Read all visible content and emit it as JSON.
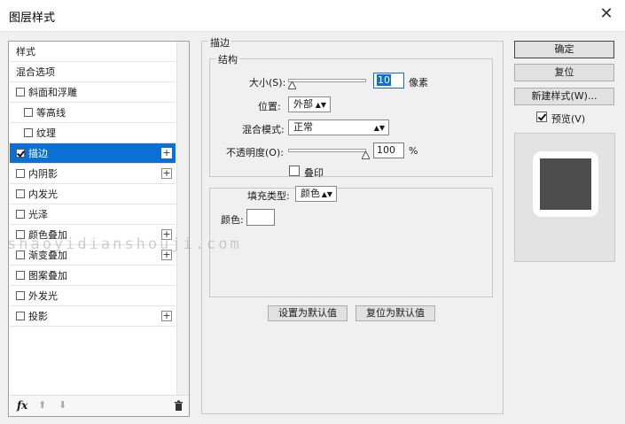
{
  "window": {
    "title": "图层样式"
  },
  "list": {
    "items": [
      {
        "label": "样式",
        "checkbox": false,
        "plus": false,
        "indent": 0
      },
      {
        "label": "混合选项",
        "checkbox": false,
        "plus": false,
        "indent": 0
      },
      {
        "label": "斜面和浮雕",
        "checkbox": true,
        "checked": false,
        "plus": false,
        "indent": 0
      },
      {
        "label": "等高线",
        "checkbox": true,
        "checked": false,
        "plus": false,
        "indent": 1
      },
      {
        "label": "纹理",
        "checkbox": true,
        "checked": false,
        "plus": false,
        "indent": 1
      },
      {
        "label": "描边",
        "checkbox": true,
        "checked": true,
        "plus": true,
        "indent": 0,
        "selected": true
      },
      {
        "label": "内阴影",
        "checkbox": true,
        "checked": false,
        "plus": true,
        "indent": 0
      },
      {
        "label": "内发光",
        "checkbox": true,
        "checked": false,
        "plus": false,
        "indent": 0
      },
      {
        "label": "光泽",
        "checkbox": true,
        "checked": false,
        "plus": false,
        "indent": 0
      },
      {
        "label": "颜色叠加",
        "checkbox": true,
        "checked": false,
        "plus": true,
        "indent": 0
      },
      {
        "label": "渐变叠加",
        "checkbox": true,
        "checked": false,
        "plus": true,
        "indent": 0
      },
      {
        "label": "图案叠加",
        "checkbox": true,
        "checked": false,
        "plus": false,
        "indent": 0
      },
      {
        "label": "外发光",
        "checkbox": true,
        "checked": false,
        "plus": false,
        "indent": 0
      },
      {
        "label": "投影",
        "checkbox": true,
        "checked": false,
        "plus": true,
        "indent": 0
      }
    ],
    "footer": {
      "fx": "fx"
    }
  },
  "stroke": {
    "group_title": "描边",
    "structure_title": "结构",
    "size_label": "大小(S):",
    "size_value": "10",
    "size_unit": "像素",
    "size_fraction": 0.03,
    "position_label": "位置:",
    "position_value": "外部",
    "blend_label": "混合模式:",
    "blend_value": "正常",
    "opacity_label": "不透明度(O):",
    "opacity_value": "100",
    "opacity_unit": "%",
    "opacity_fraction": 1.0,
    "overprint_label": "叠印",
    "fill_type_label": "填充类型:",
    "fill_type_value": "颜色",
    "color_label": "颜色:",
    "color_value": "#ffffff",
    "set_default": "设置为默认值",
    "reset_default": "复位为默认值"
  },
  "right": {
    "ok": "确定",
    "reset": "复位",
    "new_style": "新建样式(W)...",
    "preview_label": "预览(V)"
  },
  "watermark": "shaoyidianshouji.com",
  "colors": {
    "selection": "#0b6fd3",
    "preview_fill": "#4d4d4d"
  }
}
